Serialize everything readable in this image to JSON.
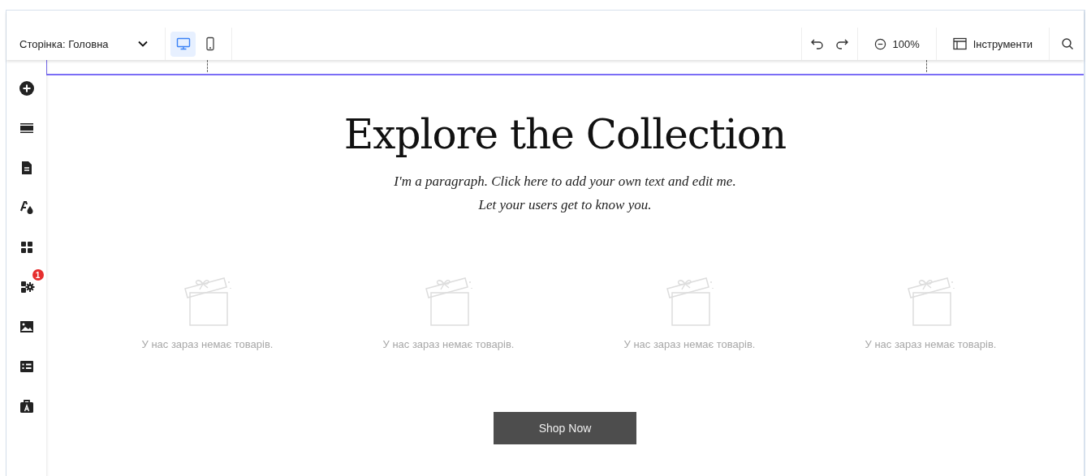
{
  "toolbar": {
    "page_selector": "Сторінка: Головна",
    "devices": [
      {
        "kind": "desktop",
        "selected": true
      },
      {
        "kind": "mobile",
        "selected": false
      }
    ],
    "zoom": "100%",
    "tools": "Інструменти"
  },
  "sidebar": {
    "items": [
      {
        "kind": "add"
      },
      {
        "kind": "sections"
      },
      {
        "kind": "pages"
      },
      {
        "kind": "design"
      },
      {
        "kind": "apps"
      },
      {
        "kind": "extensions",
        "badge": "1"
      },
      {
        "kind": "media"
      },
      {
        "kind": "cms"
      },
      {
        "kind": "business"
      }
    ]
  },
  "canvas": {
    "title": "Explore the Collection",
    "paragraph": [
      "I'm a paragraph. Click here to add your own text and edit me.",
      "Let your users get to know you."
    ],
    "products": [
      {
        "empty_text": "У нас зараз немає товарів."
      },
      {
        "empty_text": "У нас зараз немає товарів."
      },
      {
        "empty_text": "У нас зараз немає товарів."
      },
      {
        "empty_text": "У нас зараз немає товарів."
      }
    ],
    "button": "Shop Now"
  }
}
